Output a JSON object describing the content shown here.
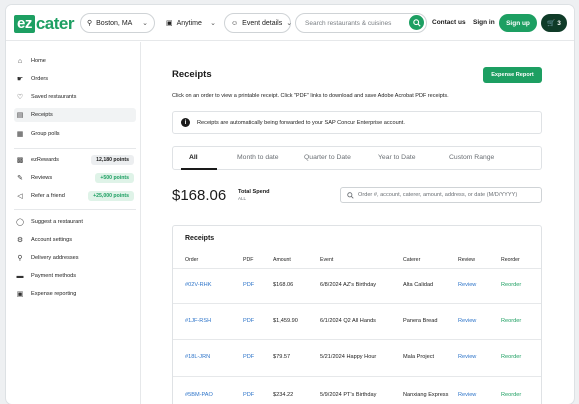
{
  "header": {
    "logo_ez": "ez",
    "logo_cater": "cater",
    "location": "Boston, MA",
    "time": "Anytime",
    "event_details": "Event details",
    "search_placeholder": "Search restaurants & cuisines",
    "contact": "Contact us",
    "signin": "Sign in",
    "signup": "Sign up",
    "cart_count": "3"
  },
  "sidebar": {
    "items": [
      {
        "label": "Home",
        "icon": "home-icon"
      },
      {
        "label": "Orders",
        "icon": "orders-icon"
      },
      {
        "label": "Saved restaurants",
        "icon": "heart-icon"
      },
      {
        "label": "Receipts",
        "icon": "receipt-icon"
      },
      {
        "label": "Group polls",
        "icon": "poll-icon"
      }
    ],
    "rewards": [
      {
        "label": "ezRewards",
        "badge": "12,180 points"
      },
      {
        "label": "Reviews",
        "badge": "+500 points"
      },
      {
        "label": "Refer a friend",
        "badge": "+25,000 points"
      }
    ],
    "account": [
      {
        "label": "Suggest a restaurant"
      },
      {
        "label": "Account settings"
      },
      {
        "label": "Delivery addresses"
      },
      {
        "label": "Payment methods"
      },
      {
        "label": "Expense reporting"
      }
    ]
  },
  "main": {
    "title": "Receipts",
    "expense_button": "Expense Report",
    "intro": "Click on an order to view a printable receipt. Click \"PDF\" links to download and save Adobe Acrobat PDF receipts.",
    "banner": "Receipts are automatically being forwarded to your SAP Concur Enterprise account.",
    "tabs": [
      "All",
      "Month to date",
      "Quarter to Date",
      "Year to Date",
      "Custom Range"
    ],
    "total_amount": "$168.06",
    "total_label": "Total Spend",
    "total_sub": "ALL",
    "search_placeholder": "Order #, account, caterer, amount, address, or date (M/D/YYYY)",
    "table": {
      "title": "Receipts",
      "headers": [
        "Order",
        "PDF",
        "Amount",
        "Event",
        "Caterer",
        "Review",
        "Reorder"
      ],
      "rows": [
        {
          "order": "#02V-RHK",
          "pdf": "PDF",
          "amount": "$168.06",
          "event": "6/8/2024 AZ's Birthday",
          "caterer": "Alta Calidad",
          "review": "Review",
          "reorder": "Reorder"
        },
        {
          "order": "#1JF-RSH",
          "pdf": "PDF",
          "amount": "$1,459.90",
          "event": "6/1/2024 Q2 All Hands",
          "caterer": "Panera Bread",
          "review": "Review",
          "reorder": "Reorder"
        },
        {
          "order": "#18L-JRN",
          "pdf": "PDF",
          "amount": "$79.57",
          "event": "5/21/2024 Happy Hour",
          "caterer": "Mala Project",
          "review": "Review",
          "reorder": "Reorder"
        },
        {
          "order": "#5BM-PAO",
          "pdf": "PDF",
          "amount": "$234.22",
          "event": "5/9/2024 PT's Birthday",
          "caterer": "Nanxiang Express",
          "review": "Review",
          "reorder": "Reorder"
        }
      ]
    }
  },
  "colors": {
    "brand_green": "#1d9f62",
    "link_blue": "#2d74c9",
    "cart_dark": "#0f3b28"
  }
}
